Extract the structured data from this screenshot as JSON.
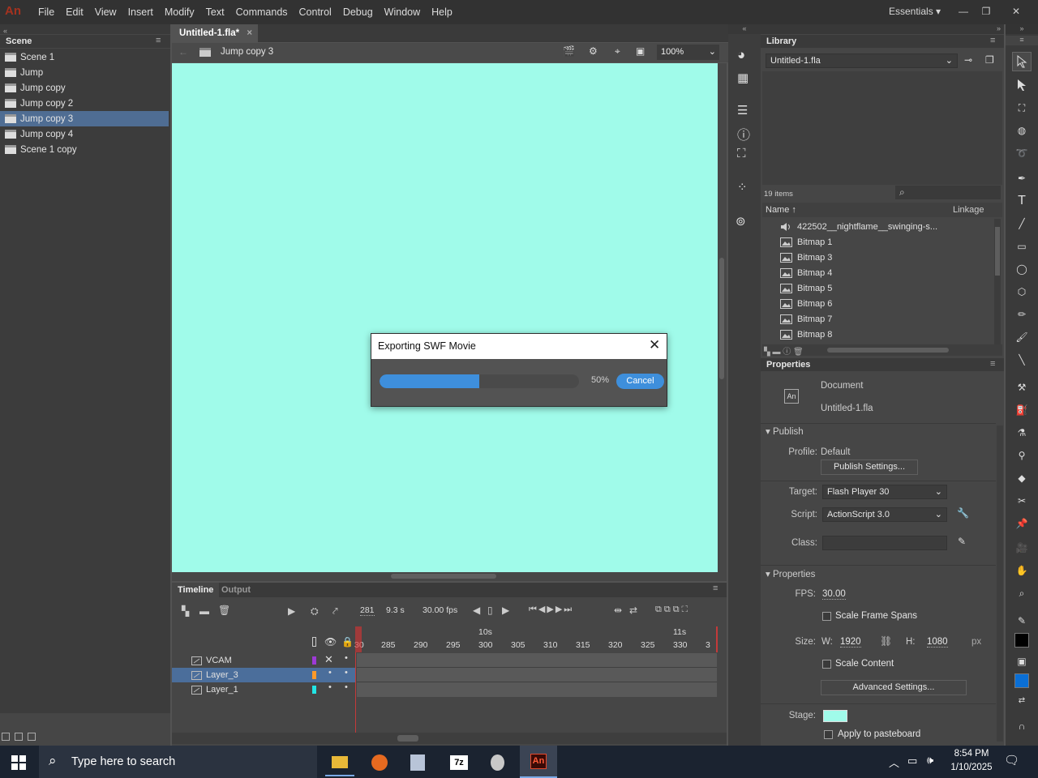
{
  "app": {
    "logo": "An"
  },
  "menu": [
    "File",
    "Edit",
    "View",
    "Insert",
    "Modify",
    "Text",
    "Commands",
    "Control",
    "Debug",
    "Window",
    "Help"
  ],
  "workspace": "Essentials",
  "scene_panel": {
    "title": "Scene",
    "items": [
      {
        "label": "Scene 1",
        "selected": false
      },
      {
        "label": "Jump",
        "selected": false
      },
      {
        "label": "Jump copy",
        "selected": false
      },
      {
        "label": "Jump copy 2",
        "selected": false
      },
      {
        "label": "Jump copy 3",
        "selected": true
      },
      {
        "label": "Jump copy 4",
        "selected": false
      },
      {
        "label": "Scene 1 copy",
        "selected": false
      }
    ]
  },
  "document": {
    "tab": "Untitled-1.fla*",
    "scene": "Jump copy 3",
    "zoom": "100%",
    "stage_color": "#a0fbea"
  },
  "dialog": {
    "title": "Exporting SWF Movie",
    "progress": 0.5,
    "percent": "50%",
    "cancel": "Cancel"
  },
  "timeline": {
    "tabs": [
      "Timeline",
      "Output"
    ],
    "current_frame": "281",
    "seconds": "9.3",
    "seconds_unit": "s",
    "fps": "30.00",
    "fps_unit": "fps",
    "time_markers": [
      "10s",
      "11s"
    ],
    "frame_numbers": [
      "30",
      "285",
      "290",
      "295",
      "300",
      "305",
      "310",
      "315",
      "320",
      "325",
      "330",
      "3"
    ],
    "layers": [
      {
        "name": "VCAM",
        "color": "#9d3ad6",
        "selected": false
      },
      {
        "name": "Layer_3",
        "color": "#ff9a2a",
        "selected": true
      },
      {
        "name": "Layer_1",
        "color": "#22e5e5",
        "selected": false
      }
    ]
  },
  "library": {
    "title": "Library",
    "file": "Untitled-1.fla",
    "count": "19 items",
    "col_name": "Name",
    "col_linkage": "Linkage",
    "items": [
      {
        "label": "422502__nightflame__swinging-s...",
        "icon": "sound-icon"
      },
      {
        "label": "Bitmap 1",
        "icon": "bitmap-icon"
      },
      {
        "label": "Bitmap 3",
        "icon": "bitmap-icon"
      },
      {
        "label": "Bitmap 4",
        "icon": "bitmap-icon"
      },
      {
        "label": "Bitmap 5",
        "icon": "bitmap-icon"
      },
      {
        "label": "Bitmap 6",
        "icon": "bitmap-icon"
      },
      {
        "label": "Bitmap 7",
        "icon": "bitmap-icon"
      },
      {
        "label": "Bitmap 8",
        "icon": "bitmap-icon"
      }
    ]
  },
  "properties": {
    "title": "Properties",
    "doc_type": "Document",
    "doc_name": "Untitled-1.fla",
    "doc_icon": "An",
    "publish_header": "Publish",
    "profile_label": "Profile:",
    "profile_value": "Default",
    "publish_settings": "Publish Settings...",
    "target_label": "Target:",
    "target_value": "Flash Player 30",
    "script_label": "Script:",
    "script_value": "ActionScript 3.0",
    "class_label": "Class:",
    "class_value": "",
    "props_header": "Properties",
    "fps_label": "FPS:",
    "fps_value": "30.00",
    "scale_spans": "Scale Frame Spans",
    "size_label": "Size:",
    "w_label": "W:",
    "w_value": "1920",
    "h_label": "H:",
    "h_value": "1080",
    "unit": "px",
    "scale_content": "Scale Content",
    "advanced": "Advanced Settings...",
    "stage_label": "Stage:",
    "stage_color": "#a0fbea",
    "apply_pasteboard": "Apply to pasteboard"
  },
  "taskbar": {
    "search_placeholder": "Type here to search",
    "time": "8:54 PM",
    "date": "1/10/2025"
  }
}
